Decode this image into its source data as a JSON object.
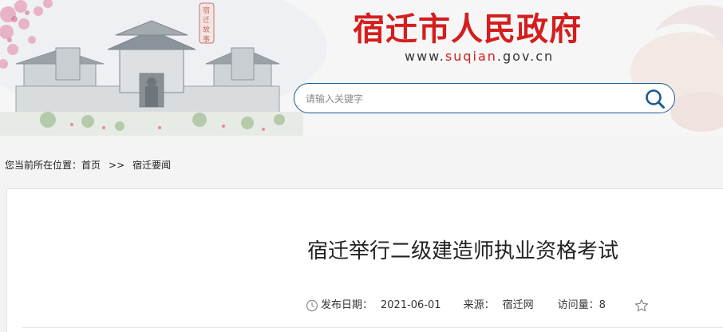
{
  "header": {
    "site_title": "宿迁市人民政府",
    "url_prefix": "www.",
    "url_domain": "suqian",
    "url_suffix": ".gov.cn",
    "title_color": "#d41e1e",
    "banner_icon": "city-gate-illustration-icon",
    "seal_text": "宿迁故事"
  },
  "search": {
    "placeholder": "请输入关键字",
    "value": "",
    "icon": "search-icon",
    "border_color": "#1c5a8e"
  },
  "breadcrumb": {
    "prefix": "您当前所在位置：",
    "home": "首页",
    "separator": ">>",
    "current": "宿迁要闻"
  },
  "article": {
    "title": "宿迁举行二级建造师执业资格考试",
    "date_label": "发布日期：",
    "date_value": "2021-06-01",
    "source_label": "来源：",
    "source_value": "宿迁网",
    "views_label": "访问量：",
    "views_value": "8",
    "date_icon": "clock-icon",
    "favorite_icon": "star-icon"
  }
}
